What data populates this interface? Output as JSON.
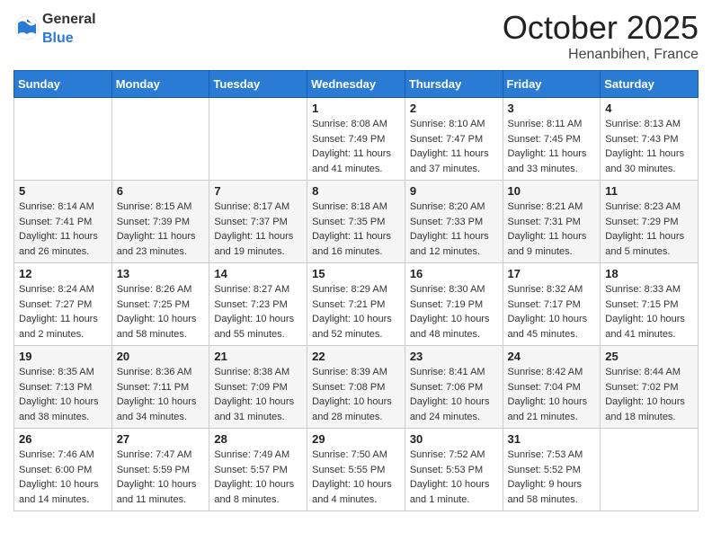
{
  "header": {
    "logo_general": "General",
    "logo_blue": "Blue",
    "month_title": "October 2025",
    "location": "Henanbihen, France"
  },
  "days_of_week": [
    "Sunday",
    "Monday",
    "Tuesday",
    "Wednesday",
    "Thursday",
    "Friday",
    "Saturday"
  ],
  "weeks": [
    [
      {
        "day": "",
        "info": ""
      },
      {
        "day": "",
        "info": ""
      },
      {
        "day": "",
        "info": ""
      },
      {
        "day": "1",
        "info": "Sunrise: 8:08 AM\nSunset: 7:49 PM\nDaylight: 11 hours\nand 41 minutes."
      },
      {
        "day": "2",
        "info": "Sunrise: 8:10 AM\nSunset: 7:47 PM\nDaylight: 11 hours\nand 37 minutes."
      },
      {
        "day": "3",
        "info": "Sunrise: 8:11 AM\nSunset: 7:45 PM\nDaylight: 11 hours\nand 33 minutes."
      },
      {
        "day": "4",
        "info": "Sunrise: 8:13 AM\nSunset: 7:43 PM\nDaylight: 11 hours\nand 30 minutes."
      }
    ],
    [
      {
        "day": "5",
        "info": "Sunrise: 8:14 AM\nSunset: 7:41 PM\nDaylight: 11 hours\nand 26 minutes."
      },
      {
        "day": "6",
        "info": "Sunrise: 8:15 AM\nSunset: 7:39 PM\nDaylight: 11 hours\nand 23 minutes."
      },
      {
        "day": "7",
        "info": "Sunrise: 8:17 AM\nSunset: 7:37 PM\nDaylight: 11 hours\nand 19 minutes."
      },
      {
        "day": "8",
        "info": "Sunrise: 8:18 AM\nSunset: 7:35 PM\nDaylight: 11 hours\nand 16 minutes."
      },
      {
        "day": "9",
        "info": "Sunrise: 8:20 AM\nSunset: 7:33 PM\nDaylight: 11 hours\nand 12 minutes."
      },
      {
        "day": "10",
        "info": "Sunrise: 8:21 AM\nSunset: 7:31 PM\nDaylight: 11 hours\nand 9 minutes."
      },
      {
        "day": "11",
        "info": "Sunrise: 8:23 AM\nSunset: 7:29 PM\nDaylight: 11 hours\nand 5 minutes."
      }
    ],
    [
      {
        "day": "12",
        "info": "Sunrise: 8:24 AM\nSunset: 7:27 PM\nDaylight: 11 hours\nand 2 minutes."
      },
      {
        "day": "13",
        "info": "Sunrise: 8:26 AM\nSunset: 7:25 PM\nDaylight: 10 hours\nand 58 minutes."
      },
      {
        "day": "14",
        "info": "Sunrise: 8:27 AM\nSunset: 7:23 PM\nDaylight: 10 hours\nand 55 minutes."
      },
      {
        "day": "15",
        "info": "Sunrise: 8:29 AM\nSunset: 7:21 PM\nDaylight: 10 hours\nand 52 minutes."
      },
      {
        "day": "16",
        "info": "Sunrise: 8:30 AM\nSunset: 7:19 PM\nDaylight: 10 hours\nand 48 minutes."
      },
      {
        "day": "17",
        "info": "Sunrise: 8:32 AM\nSunset: 7:17 PM\nDaylight: 10 hours\nand 45 minutes."
      },
      {
        "day": "18",
        "info": "Sunrise: 8:33 AM\nSunset: 7:15 PM\nDaylight: 10 hours\nand 41 minutes."
      }
    ],
    [
      {
        "day": "19",
        "info": "Sunrise: 8:35 AM\nSunset: 7:13 PM\nDaylight: 10 hours\nand 38 minutes."
      },
      {
        "day": "20",
        "info": "Sunrise: 8:36 AM\nSunset: 7:11 PM\nDaylight: 10 hours\nand 34 minutes."
      },
      {
        "day": "21",
        "info": "Sunrise: 8:38 AM\nSunset: 7:09 PM\nDaylight: 10 hours\nand 31 minutes."
      },
      {
        "day": "22",
        "info": "Sunrise: 8:39 AM\nSunset: 7:08 PM\nDaylight: 10 hours\nand 28 minutes."
      },
      {
        "day": "23",
        "info": "Sunrise: 8:41 AM\nSunset: 7:06 PM\nDaylight: 10 hours\nand 24 minutes."
      },
      {
        "day": "24",
        "info": "Sunrise: 8:42 AM\nSunset: 7:04 PM\nDaylight: 10 hours\nand 21 minutes."
      },
      {
        "day": "25",
        "info": "Sunrise: 8:44 AM\nSunset: 7:02 PM\nDaylight: 10 hours\nand 18 minutes."
      }
    ],
    [
      {
        "day": "26",
        "info": "Sunrise: 7:46 AM\nSunset: 6:00 PM\nDaylight: 10 hours\nand 14 minutes."
      },
      {
        "day": "27",
        "info": "Sunrise: 7:47 AM\nSunset: 5:59 PM\nDaylight: 10 hours\nand 11 minutes."
      },
      {
        "day": "28",
        "info": "Sunrise: 7:49 AM\nSunset: 5:57 PM\nDaylight: 10 hours\nand 8 minutes."
      },
      {
        "day": "29",
        "info": "Sunrise: 7:50 AM\nSunset: 5:55 PM\nDaylight: 10 hours\nand 4 minutes."
      },
      {
        "day": "30",
        "info": "Sunrise: 7:52 AM\nSunset: 5:53 PM\nDaylight: 10 hours\nand 1 minute."
      },
      {
        "day": "31",
        "info": "Sunrise: 7:53 AM\nSunset: 5:52 PM\nDaylight: 9 hours\nand 58 minutes."
      },
      {
        "day": "",
        "info": ""
      }
    ]
  ]
}
